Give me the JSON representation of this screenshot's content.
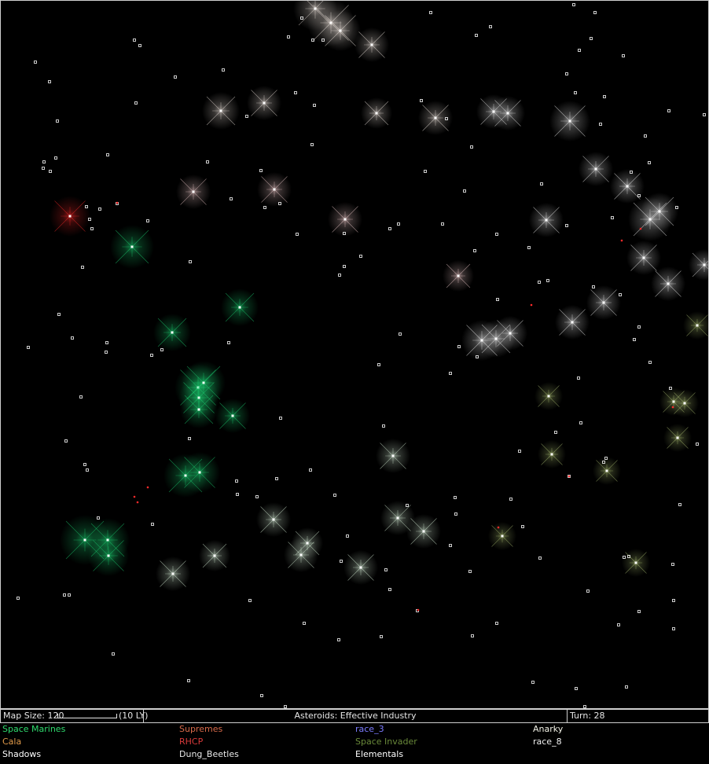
{
  "status_bar": {
    "map_size": "Map Size: 120",
    "scale": "(10 LY)",
    "tech": "Asteroids: Effective Industry",
    "turn": "Turn: 28"
  },
  "races": [
    {
      "name": "Space Marines",
      "color": "#2fdc6e"
    },
    {
      "name": "Supremes",
      "color": "#d86a4a"
    },
    {
      "name": "race_3",
      "color": "#7b7bff"
    },
    {
      "name": "Anarky",
      "color": "#f2f2e6"
    },
    {
      "name": "Cala",
      "color": "#e09a4a"
    },
    {
      "name": "RHCP",
      "color": "#d83a3a"
    },
    {
      "name": "Space Invader",
      "color": "#6a8a3a"
    },
    {
      "name": "race_8",
      "color": "#f0f0f0"
    },
    {
      "name": "Shadows",
      "color": "#ffffff"
    },
    {
      "name": "Dung_Beetles",
      "color": "#e8e8e8"
    },
    {
      "name": "Elementals",
      "color": "#ffffff"
    }
  ],
  "owner_colors": {
    "green": "#1ee07a",
    "white": "#ffffff",
    "cream": "#fff4ec",
    "sage": "#e6ffe6",
    "olive": "#b4c878",
    "rose": "#ffd8d8",
    "red": "#ff2a2a"
  }
}
